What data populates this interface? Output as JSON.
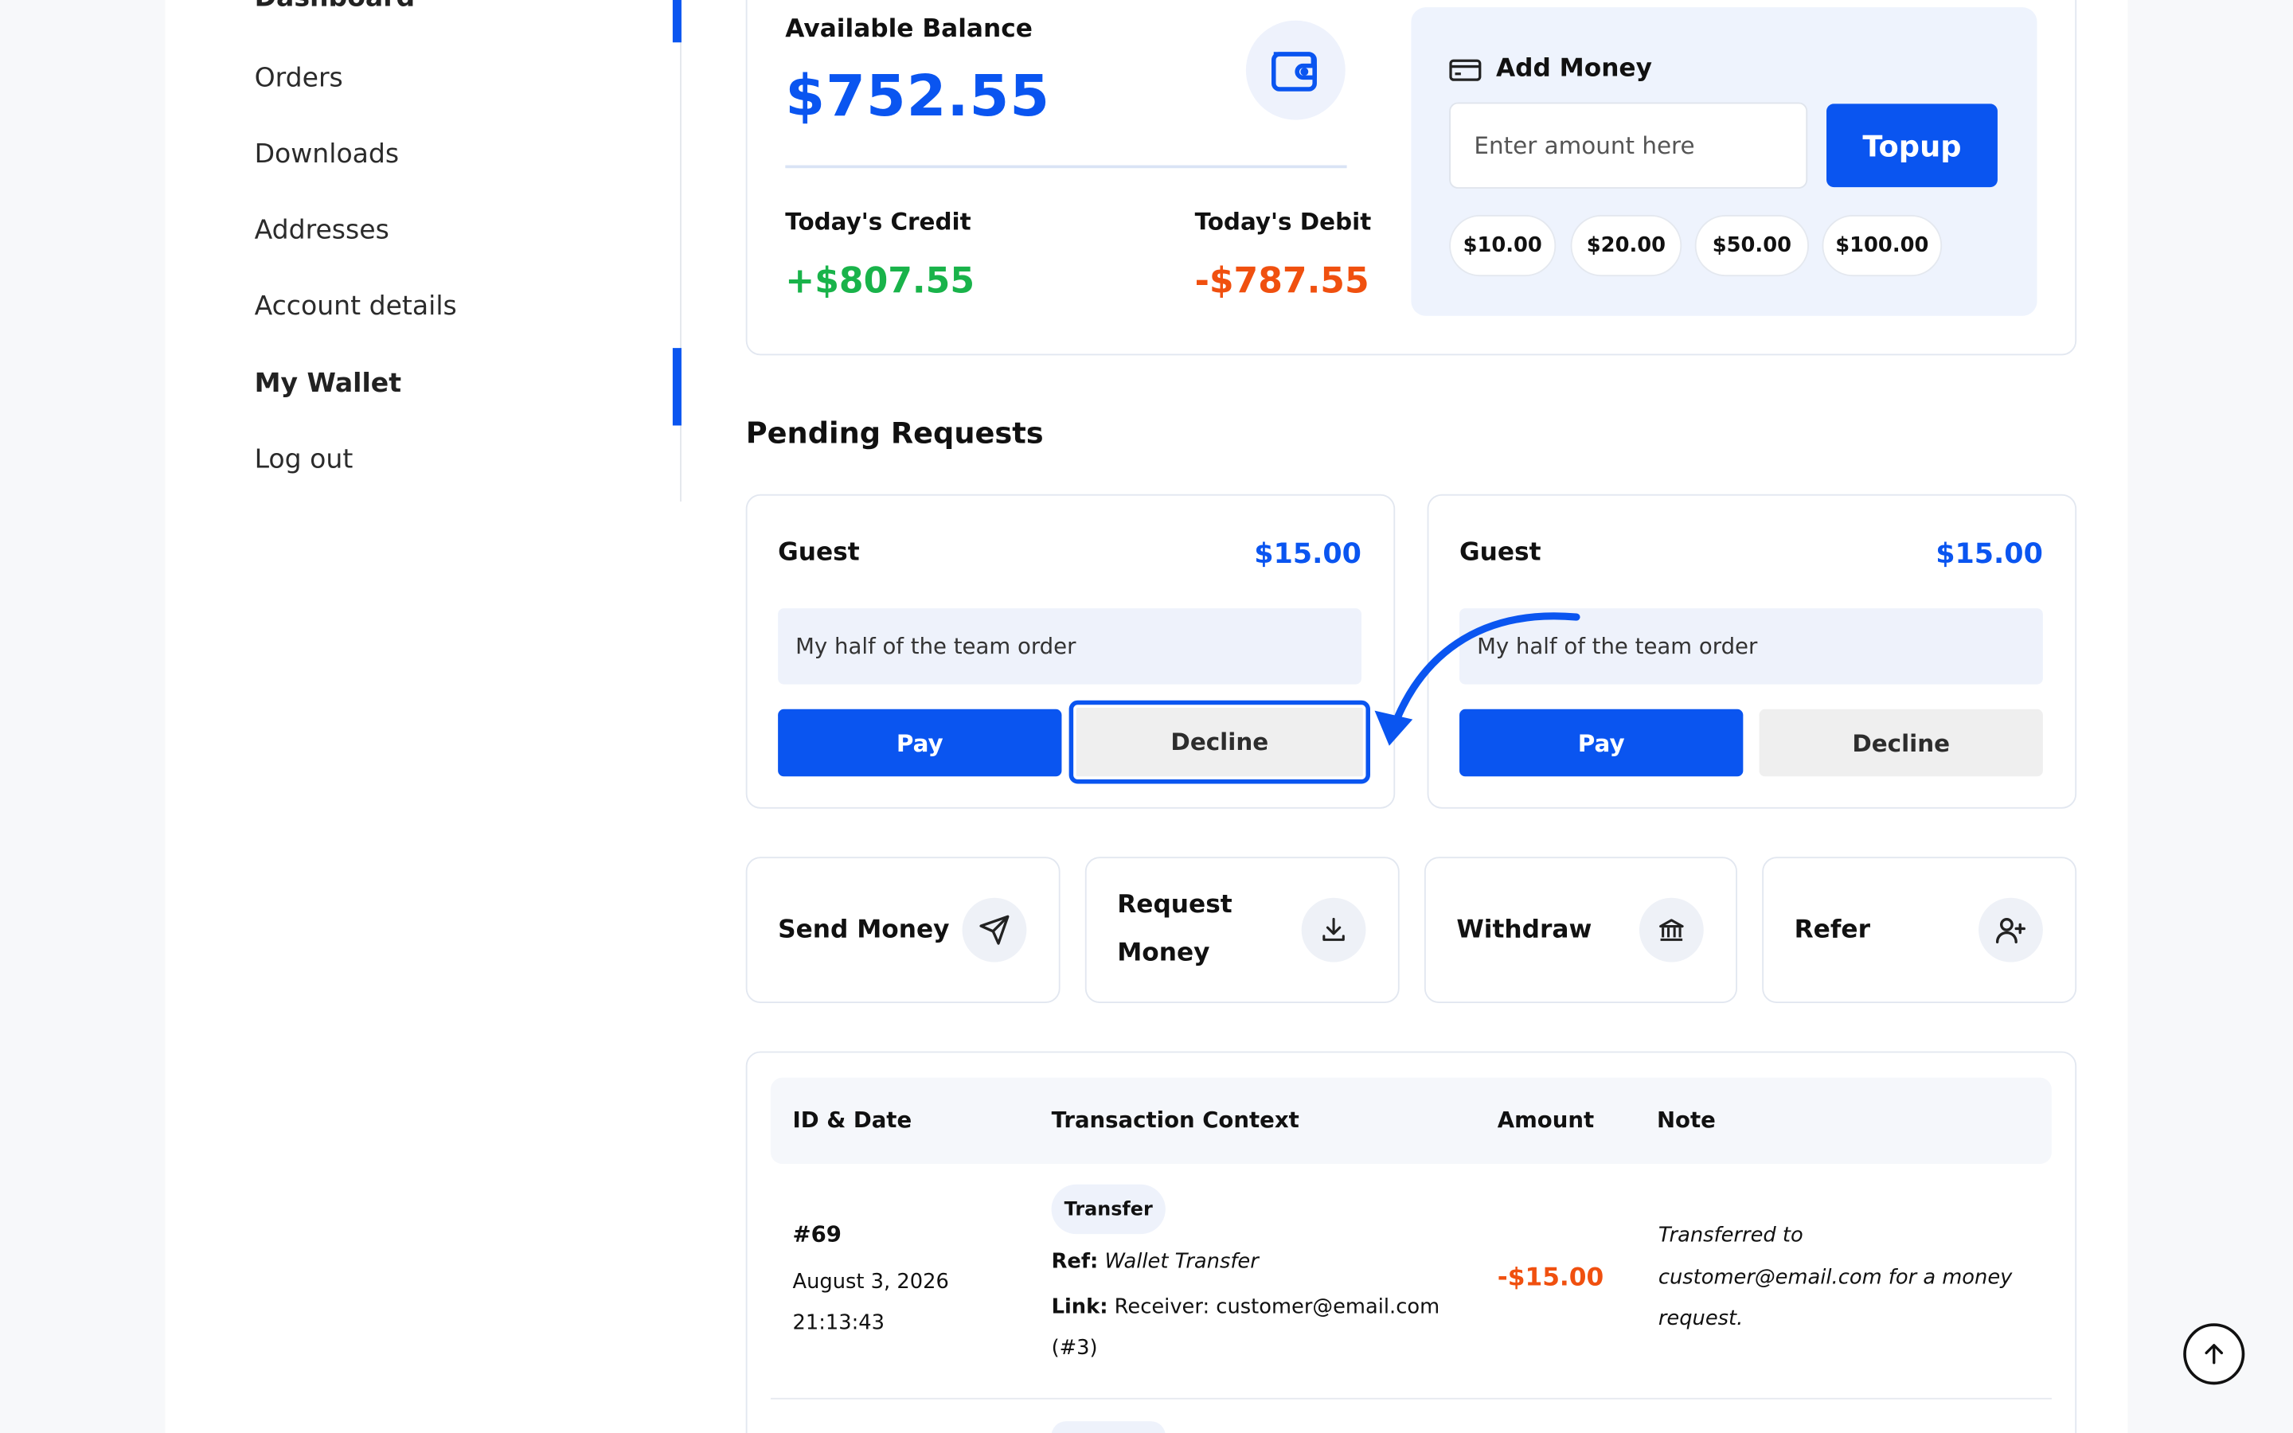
{
  "sidebar": {
    "items": [
      {
        "label": "Dashboard"
      },
      {
        "label": "Orders"
      },
      {
        "label": "Downloads"
      },
      {
        "label": "Addresses"
      },
      {
        "label": "Account details"
      },
      {
        "label": "My Wallet"
      },
      {
        "label": "Log out"
      }
    ],
    "active": "My Wallet"
  },
  "balance": {
    "label": "Available Balance",
    "amount": "$752.55",
    "credit_label": "Today's Credit",
    "credit_value": "+$807.55",
    "debit_label": "Today's Debit",
    "debit_value": "-$787.55",
    "icon": "wallet-icon"
  },
  "add_money": {
    "title": "Add Money",
    "icon": "card-icon",
    "input_placeholder": "Enter amount here",
    "input_value": "",
    "topup_label": "Topup",
    "presets": [
      "$10.00",
      "$20.00",
      "$50.00",
      "$100.00"
    ]
  },
  "pending": {
    "title": "Pending Requests",
    "requests": [
      {
        "name": "Guest",
        "amount": "$15.00",
        "note": "My half of the team order",
        "pay_label": "Pay",
        "decline_label": "Decline"
      },
      {
        "name": "Guest",
        "amount": "$15.00",
        "note": "My half of the team order",
        "pay_label": "Pay",
        "decline_label": "Decline"
      }
    ]
  },
  "actions": [
    {
      "label_line1": "Send Money",
      "label_line2": "",
      "icon": "send-icon"
    },
    {
      "label_line1": "Request",
      "label_line2": "Money",
      "icon": "download-icon"
    },
    {
      "label_line1": "Withdraw",
      "label_line2": "",
      "icon": "bank-icon"
    },
    {
      "label_line1": "Refer",
      "label_line2": "",
      "icon": "user-plus-icon"
    }
  ],
  "table": {
    "headers": [
      "ID & Date",
      "Transaction Context",
      "Amount",
      "Note"
    ],
    "rows": [
      {
        "id": "#69",
        "date": "August 3, 2026",
        "time": "21:13:43",
        "badge": "Transfer",
        "ref_label": "Ref:",
        "ref_value": "Wallet Transfer",
        "link_label": "Link:",
        "link_value": "Receiver: customer@email.com",
        "link_value2": "(#3)",
        "amount": "-$15.00",
        "note_line1": "Transferred to",
        "note_line2": "customer@email.com for a money",
        "note_line3": "request."
      }
    ]
  },
  "colors": {
    "accent": "#0a55f0",
    "credit": "#19b34a",
    "debit": "#f0500f"
  }
}
